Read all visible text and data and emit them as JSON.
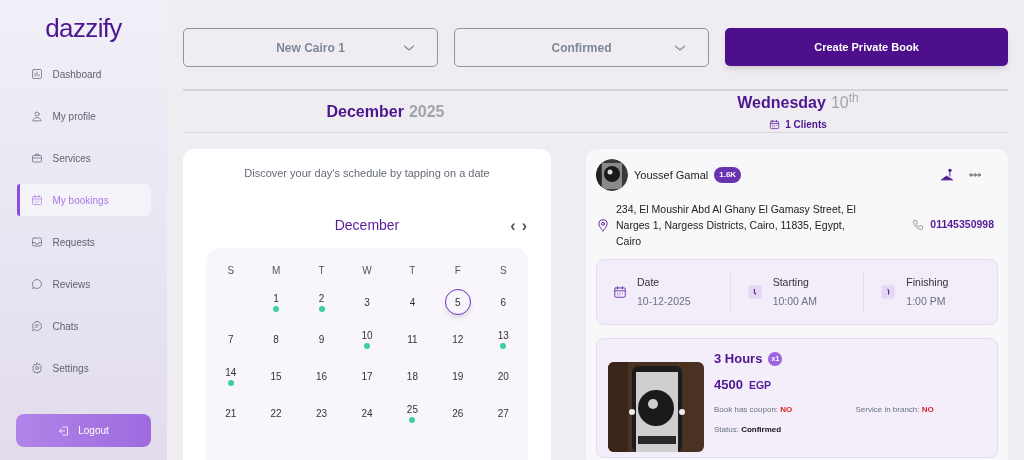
{
  "sidebar": {
    "logo": "dazzify",
    "items": [
      {
        "label": "Dashboard",
        "kind": "chart",
        "selected": false
      },
      {
        "label": "My profile",
        "kind": "user",
        "selected": false
      },
      {
        "label": "Services",
        "kind": "bag",
        "selected": false
      },
      {
        "label": "My bookings",
        "kind": "calendar",
        "selected": true
      },
      {
        "label": "Requests",
        "kind": "inbox",
        "selected": false
      },
      {
        "label": "Reviews",
        "kind": "bubble",
        "selected": false
      },
      {
        "label": "Chats",
        "kind": "chat",
        "selected": false
      },
      {
        "label": "Settings",
        "kind": "gear",
        "selected": false
      }
    ],
    "logout": "Logout"
  },
  "filters": [
    {
      "value": "New Cairo 1"
    },
    {
      "value": "Confirmed"
    }
  ],
  "create_button": "Create Private Book",
  "header": {
    "month": "December",
    "year": "2025",
    "weekday": "Wednesday",
    "day": "10",
    "day_suffix": "th",
    "clients": "1 Clients"
  },
  "calendar": {
    "hint": "Discover your day's schedule by tapping on a date",
    "month": "December",
    "prev": "‹",
    "next": "›",
    "weekdays": [
      "S",
      "M",
      "T",
      "W",
      "T",
      "F",
      "S"
    ],
    "weeks": [
      [
        {
          "day": "1",
          "booked": true,
          "selected": false
        },
        {
          "day": "2",
          "booked": true,
          "selected": false
        },
        {
          "day": "3",
          "booked": false,
          "selected": false
        },
        {
          "day": "4",
          "booked": false,
          "selected": false
        },
        {
          "day": "5",
          "booked": false,
          "selected": true
        },
        {
          "day": "6",
          "booked": false,
          "selected": false
        }
      ],
      [
        {
          "day": "7",
          "booked": false,
          "selected": false
        },
        {
          "day": "8",
          "booked": false,
          "selected": false
        },
        {
          "day": "9",
          "booked": false,
          "selected": false
        },
        {
          "day": "10",
          "booked": true,
          "selected": false
        },
        {
          "day": "11",
          "booked": false,
          "selected": false
        },
        {
          "day": "12",
          "booked": false,
          "selected": false
        },
        {
          "day": "13",
          "booked": true,
          "selected": false
        }
      ],
      [
        {
          "day": "14",
          "booked": true,
          "selected": false
        },
        {
          "day": "15",
          "booked": false,
          "selected": false
        },
        {
          "day": "16",
          "booked": false,
          "selected": false
        },
        {
          "day": "17",
          "booked": false,
          "selected": false
        },
        {
          "day": "18",
          "booked": false,
          "selected": false
        },
        {
          "day": "19",
          "booked": false,
          "selected": false
        },
        {
          "day": "20",
          "booked": false,
          "selected": false
        }
      ],
      [
        {
          "day": "21",
          "booked": false,
          "selected": false
        },
        {
          "day": "22",
          "booked": false,
          "selected": false
        },
        {
          "day": "23",
          "booked": false,
          "selected": false
        },
        {
          "day": "24",
          "booked": false,
          "selected": false
        },
        {
          "day": "25",
          "booked": true,
          "selected": false
        },
        {
          "day": "26",
          "booked": false,
          "selected": false
        },
        {
          "day": "27",
          "booked": false,
          "selected": false
        }
      ]
    ]
  },
  "booking": {
    "client": "Youssef Gamal",
    "badge": "1.6K",
    "address": "234, El Moushir Abd Al Ghany El Gamasy Street, El Narges 1, Nargess Districts, Cairo, 11835, Egypt, Cairo",
    "phone": "01145350998",
    "times": [
      {
        "kind": "date",
        "label": "Date",
        "value": "10-12-2025"
      },
      {
        "kind": "start",
        "label": "Starting",
        "value": "10:00 AM"
      },
      {
        "kind": "end",
        "label": "Finishing",
        "value": "1:00 PM"
      }
    ],
    "service": {
      "title": "3 Hours",
      "quantity": "x1",
      "price": "4500",
      "currency": "EGP",
      "facts": [
        {
          "label": "Book has coupon:",
          "value": "NO",
          "kind": "no"
        },
        {
          "label": "Service in branch:",
          "value": "NO",
          "kind": "no"
        },
        {
          "label": "Status:",
          "value": "Confirmed",
          "kind": "status"
        }
      ]
    }
  }
}
